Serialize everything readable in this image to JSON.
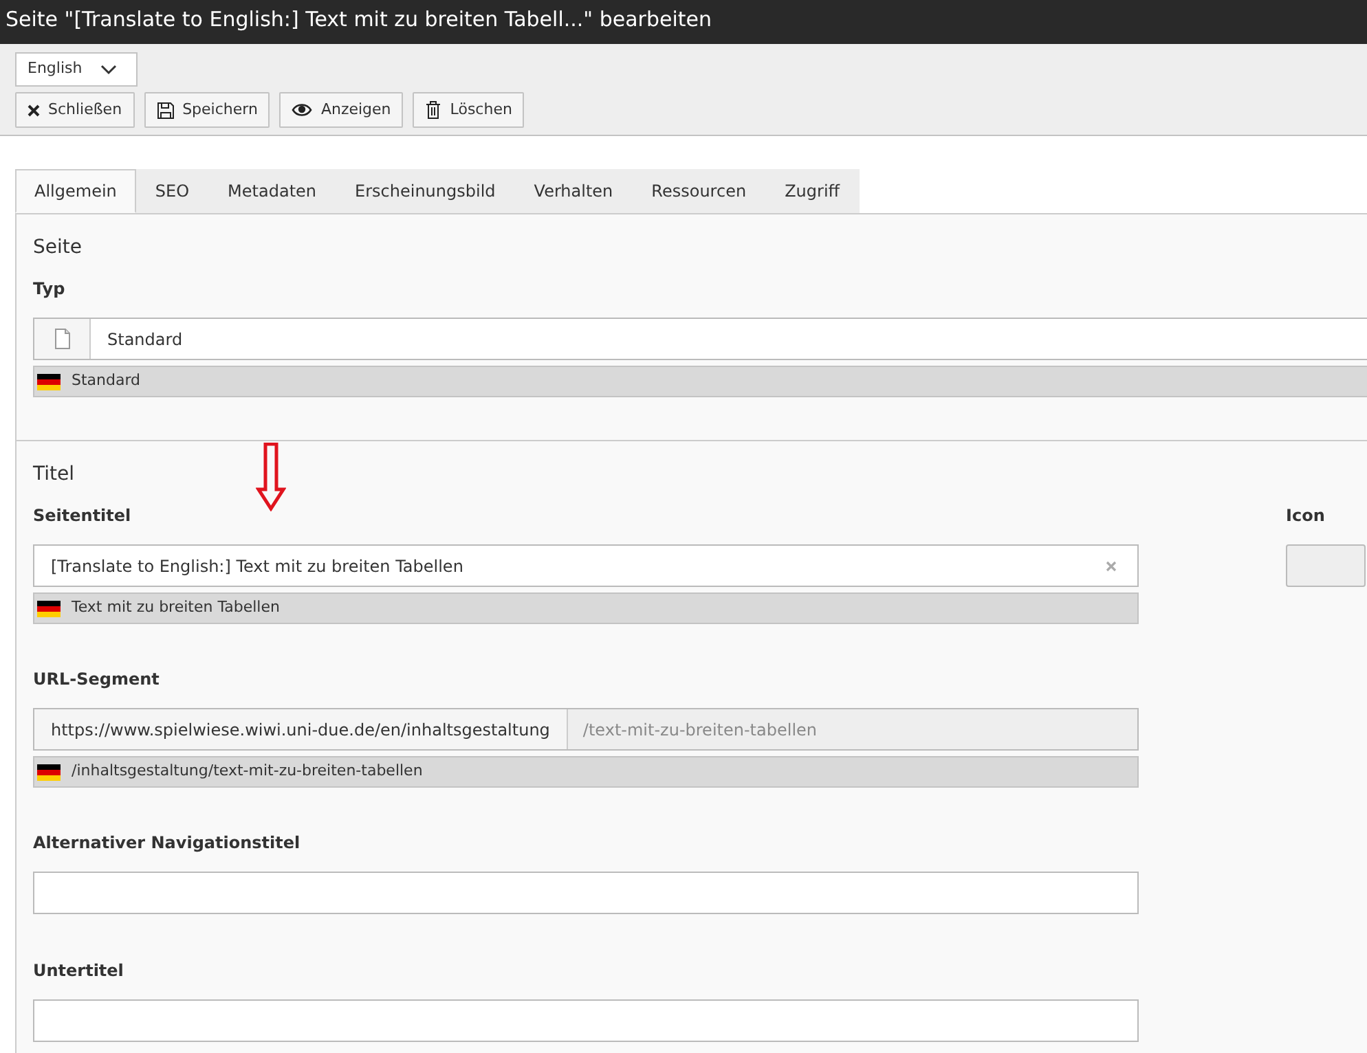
{
  "window": {
    "title": "Seite \"[Translate to English:] Text mit zu breiten Tabell...\" bearbeiten"
  },
  "language_select": {
    "value": "English"
  },
  "toolbar": [
    {
      "kind": "close",
      "label": "Schließen"
    },
    {
      "kind": "save",
      "label": "Speichern"
    },
    {
      "kind": "view",
      "label": "Anzeigen"
    },
    {
      "kind": "delete",
      "label": "Löschen"
    }
  ],
  "tabs": [
    {
      "label": "Allgemein",
      "selected": true
    },
    {
      "label": "SEO",
      "selected": false
    },
    {
      "label": "Metadaten",
      "selected": false
    },
    {
      "label": "Erscheinungsbild",
      "selected": false
    },
    {
      "label": "Verhalten",
      "selected": false
    },
    {
      "label": "Ressourcen",
      "selected": false
    },
    {
      "label": "Zugriff",
      "selected": false
    }
  ],
  "sections": [
    {
      "title": "Seite",
      "fields": [
        {
          "kind": "select",
          "label": "Typ",
          "value": "Standard",
          "translation": "Standard"
        }
      ]
    },
    {
      "title": "Titel",
      "fields": [
        {
          "kind": "text",
          "label": "Seitentitel",
          "value": "[Translate to English:] Text mit zu breiten Tabellen",
          "clearable": true,
          "translation": "Text mit zu breiten Tabellen",
          "annotated": true
        },
        {
          "kind": "url",
          "label": "URL-Segment",
          "prefix": "https://www.spielwiese.wiwi.uni-due.de/en/inhaltsgestaltung",
          "value": "/text-mit-zu-breiten-tabellen",
          "translation": "/inhaltsgestaltung/text-mit-zu-breiten-tabellen"
        },
        {
          "kind": "text",
          "label": "Alternativer Navigationstitel"
        },
        {
          "kind": "text",
          "label": "Untertitel"
        }
      ]
    }
  ],
  "icon_field": {
    "label": "Icon"
  }
}
